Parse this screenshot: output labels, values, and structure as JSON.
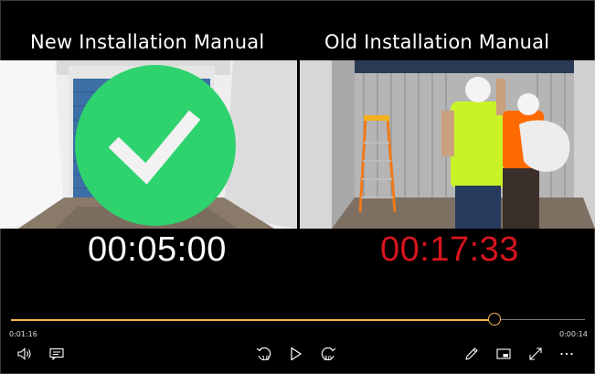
{
  "video": {
    "left_title": "New Installation Manual",
    "right_title": "Old Installation Manual",
    "left_timer": "00:05:00",
    "right_timer": "00:17:33"
  },
  "player": {
    "elapsed": "0:01:16",
    "remaining": "0:00:14",
    "progress_fraction": 0.843,
    "accent_color": "#f1b44c",
    "skip_back_label": "10",
    "skip_forward_label": "30"
  },
  "colors": {
    "check_circle": "#2ed36e",
    "old_timer": "#d7141e",
    "vest": "#c9f227",
    "orange_vest": "#ff6a00"
  },
  "icons": [
    "volume-icon",
    "captions-icon",
    "skip-back-10-icon",
    "play-icon",
    "skip-forward-30-icon",
    "edit-pen-icon",
    "miniplayer-icon",
    "fullscreen-icon",
    "more-icon"
  ]
}
